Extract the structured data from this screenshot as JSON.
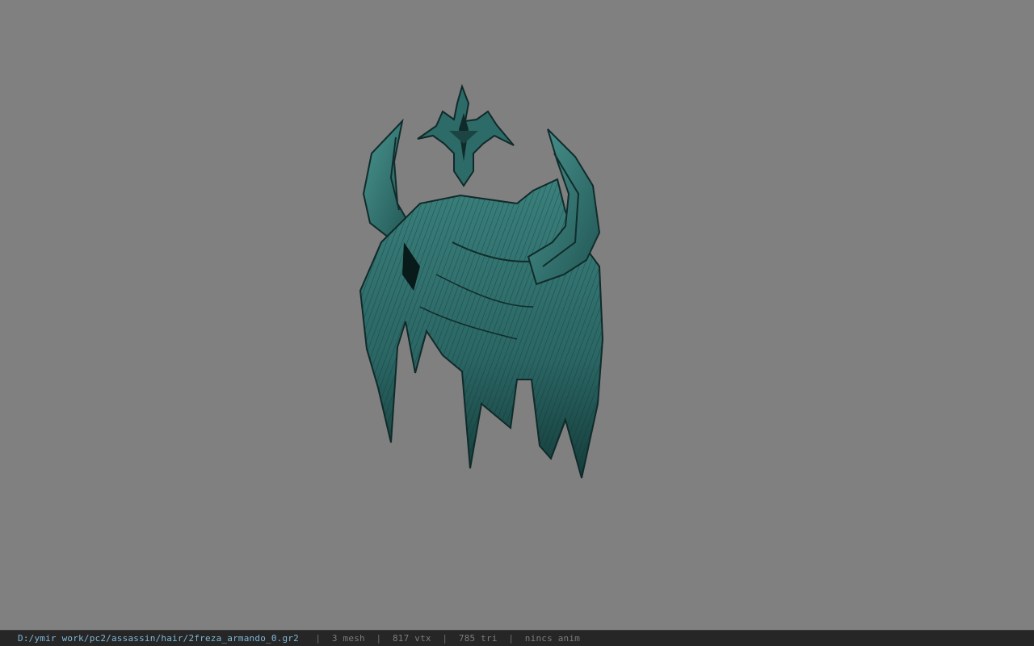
{
  "viewer": {
    "background_color": "#808080",
    "model": {
      "description_icon": "hair-mesh-preview",
      "primary_color": "#2f6f6c",
      "dark_color": "#0f2a29"
    }
  },
  "status_bar": {
    "file_path": "D:/ymir work/pc2/assassin/hair/2freza_armando_0.gr2",
    "separator": "|",
    "mesh_count": "3 mesh",
    "vertex_count": "817 vtx",
    "triangle_count": "785 tri",
    "anim_status": "nincs anim",
    "path_color": "#7fb8d8",
    "stat_color": "#7c7c7c"
  }
}
